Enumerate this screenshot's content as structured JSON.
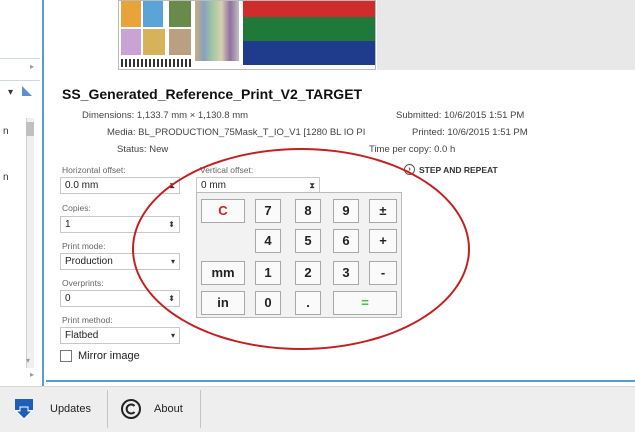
{
  "job": {
    "title": "SS_Generated_Reference_Print_V2_TARGET",
    "dimensions": "Dimensions: 1,133.7 mm × 1,130.8 mm",
    "media": "Media: BL_PRODUCTION_75Mask_T_IO_V1 [1280 BL IO PI",
    "status": "Status: New",
    "submitted": "Submitted: 10/6/2015 1:51 PM",
    "printed": "Printed: 10/6/2015 1:51 PM",
    "time_per_copy": "Time per copy: 0.0 h"
  },
  "form": {
    "horizontal_offset_label": "Horizontal offset:",
    "horizontal_offset_value": "0.0 mm",
    "vertical_offset_label": "Vertical offset:",
    "vertical_offset_value": "0 mm",
    "copies_label": "Copies:",
    "copies_value": "1",
    "print_mode_label": "Print mode:",
    "print_mode_value": "Production",
    "overprints_label": "Overprints:",
    "overprints_value": "0",
    "print_method_label": "Print method:",
    "print_method_value": "Flatbed",
    "mirror_label": "Mirror image",
    "step_and_repeat": "STEP AND REPEAT"
  },
  "keypad": {
    "clear": "C",
    "k7": "7",
    "k8": "8",
    "k9": "9",
    "plusminus": "±",
    "k4": "4",
    "k5": "5",
    "k6": "6",
    "plus": "+",
    "mm": "mm",
    "k1": "1",
    "k2": "2",
    "k3": "3",
    "minus": "-",
    "in": "in",
    "k0": "0",
    "dot": ".",
    "equals": "="
  },
  "bottombar": {
    "updates": "Updates",
    "about": "About"
  },
  "colors": {
    "accent_blue": "#5a9bd5",
    "highlight_red": "#c42020",
    "equals_green": "#2fbf2f"
  }
}
